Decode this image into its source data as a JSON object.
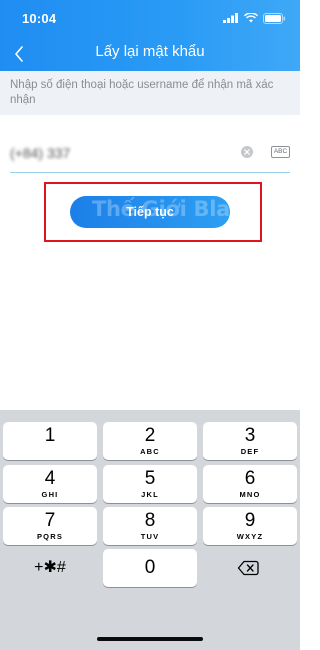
{
  "status_bar": {
    "time": "10:04"
  },
  "header": {
    "title": "Lấy lại mật khẩu"
  },
  "hint": {
    "text": "Nhập số điện thoại hoặc username để nhận mã xác nhận"
  },
  "phone_field": {
    "value": "(+84) 337",
    "keyboard_toggle": "ABC"
  },
  "continue_button": {
    "label": "Tiếp tục"
  },
  "watermark": {
    "text": "Thế Giới Black"
  },
  "keypad": {
    "keys": [
      {
        "digit": "1",
        "letters": ""
      },
      {
        "digit": "2",
        "letters": "ABC"
      },
      {
        "digit": "3",
        "letters": "DEF"
      },
      {
        "digit": "4",
        "letters": "GHI"
      },
      {
        "digit": "5",
        "letters": "JKL"
      },
      {
        "digit": "6",
        "letters": "MNO"
      },
      {
        "digit": "7",
        "letters": "PQRS"
      },
      {
        "digit": "8",
        "letters": "TUV"
      },
      {
        "digit": "9",
        "letters": "WXYZ"
      }
    ],
    "zero": "0",
    "symbols": "+✱#",
    "delete_icon": "backspace-icon"
  },
  "colors": {
    "header_start": "#1f8df2",
    "header_end": "#3fa8f7",
    "highlight_border": "#e0141e",
    "keypad_bg": "#d3d6db"
  }
}
